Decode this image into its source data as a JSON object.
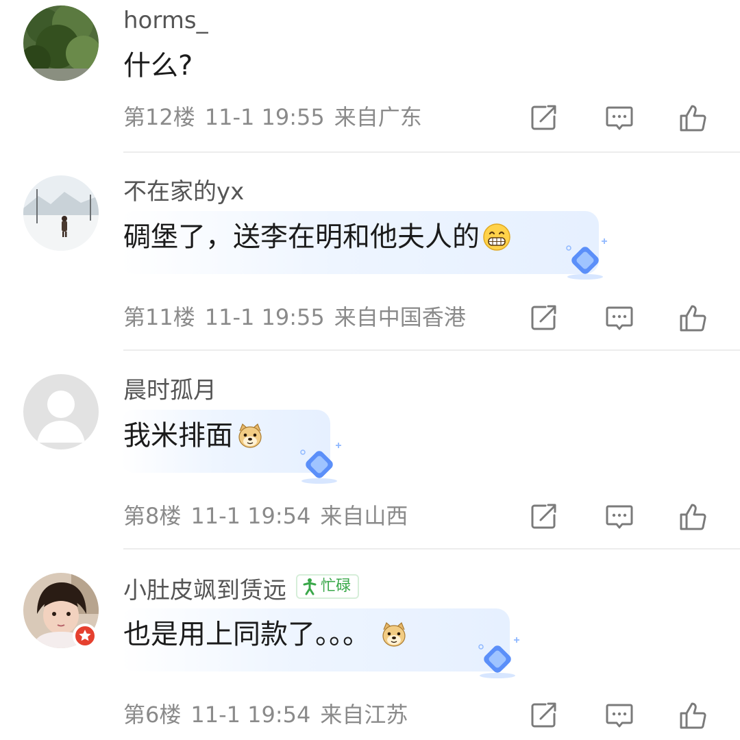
{
  "comments": [
    {
      "username": "horms_",
      "text": "什么?",
      "floor": "第12楼",
      "time": "11-1 19:55",
      "location": "来自广东",
      "avatar_icon": "tree-avatar"
    },
    {
      "username": "不在家的yx",
      "text": "碉堡了，送李在明和他夫人的",
      "emoji_icon": "grinning-face-icon",
      "floor": "第11楼",
      "time": "11-1 19:55",
      "location": "来自中国香港",
      "avatar_icon": "snow-landscape-avatar"
    },
    {
      "username": "晨时孤月",
      "text": "我米排面",
      "emoji_icon": "doge-icon",
      "floor": "第8楼",
      "time": "11-1 19:54",
      "location": "来自山西",
      "avatar_icon": "default-user-avatar"
    },
    {
      "username": "小肚皮飒到赁远",
      "vip_label": "忙碌",
      "text": "也是用上同款了。。。",
      "emoji_icon": "doge-icon",
      "floor": "第6楼",
      "time": "11-1 19:54",
      "location": "来自江苏",
      "avatar_icon": "child-photo-avatar"
    }
  ],
  "actions": [
    "share-icon",
    "reply-icon",
    "like-icon"
  ],
  "colors": {
    "meta_text": "#8a8a8a",
    "username_text": "#555555",
    "bubble": "#eef5ff",
    "gem": "#5b8ff9",
    "vip_green": "#3aa84a",
    "badge_red": "#e5402f"
  }
}
